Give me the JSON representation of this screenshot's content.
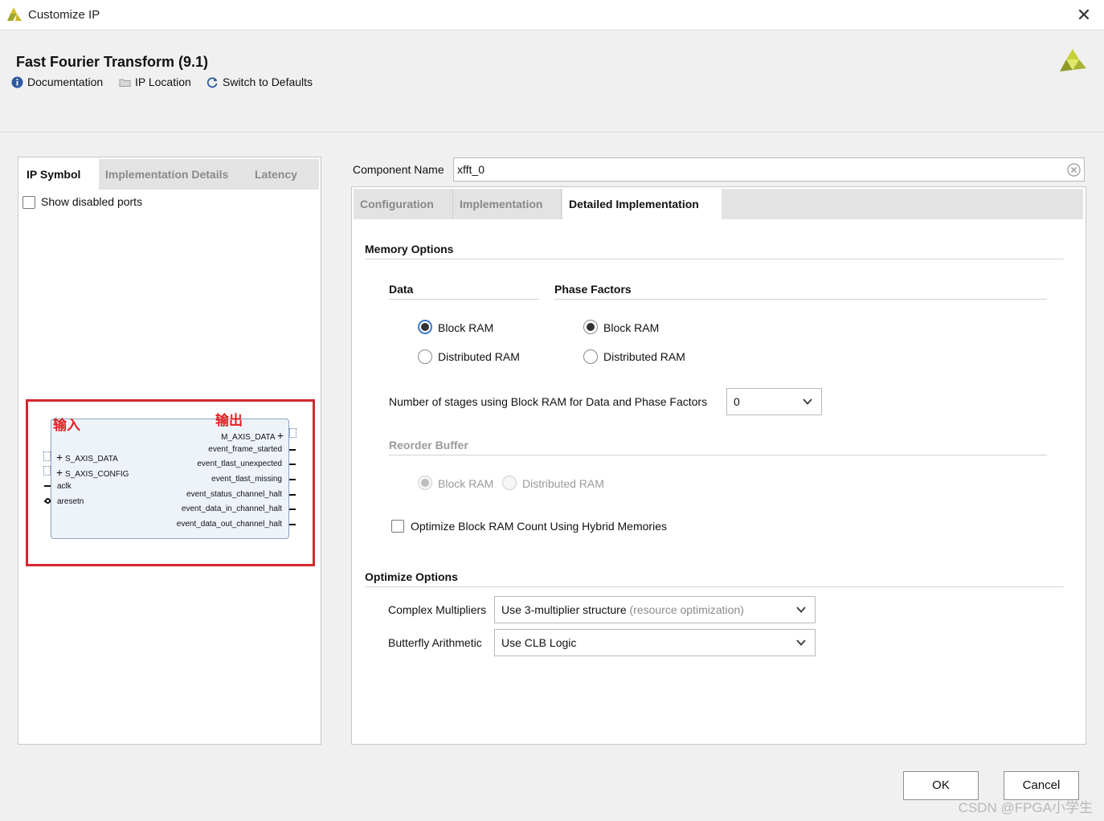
{
  "window": {
    "title": "Customize IP",
    "close_glyph": "✕"
  },
  "header": {
    "ip_title": "Fast Fourier Transform (9.1)",
    "links": [
      {
        "label": "Documentation",
        "icon": "info-icon"
      },
      {
        "label": "IP Location",
        "icon": "folder-icon"
      },
      {
        "label": "Switch to Defaults",
        "icon": "refresh-icon"
      }
    ]
  },
  "left_panel": {
    "tabs": [
      "IP Symbol",
      "Implementation Details",
      "Latency"
    ],
    "active_tab": "IP Symbol",
    "show_disabled_ports": {
      "label": "Show disabled ports",
      "checked": false
    },
    "symbol": {
      "inputs": [
        "S_AXIS_DATA",
        "S_AXIS_CONFIG",
        "aclk",
        "aresetn"
      ],
      "outputs": [
        "M_AXIS_DATA",
        "event_frame_started",
        "event_tlast_unexpected",
        "event_tlast_missing",
        "event_status_channel_halt",
        "event_data_in_channel_halt",
        "event_data_out_channel_halt"
      ],
      "annotation_input": "输入",
      "annotation_output": "输出"
    }
  },
  "right_panel": {
    "component_name_label": "Component Name",
    "component_name_value": "xfft_0",
    "tabs": [
      "Configuration",
      "Implementation",
      "Detailed Implementation"
    ],
    "active_tab": "Detailed Implementation",
    "memory_options": {
      "title": "Memory Options",
      "data": {
        "title": "Data",
        "options": [
          "Block RAM",
          "Distributed RAM"
        ],
        "selected": "Block RAM"
      },
      "phase_factors": {
        "title": "Phase Factors",
        "options": [
          "Block RAM",
          "Distributed RAM"
        ],
        "selected": "Block RAM"
      },
      "stages_label": "Number of stages using Block RAM for Data and Phase Factors",
      "stages_value": "0",
      "reorder_buffer": {
        "title": "Reorder Buffer",
        "options": [
          "Block RAM",
          "Distributed RAM"
        ],
        "selected": "Block RAM",
        "disabled": true
      },
      "hybrid": {
        "label": "Optimize Block RAM Count Using Hybrid Memories",
        "checked": false
      }
    },
    "optimize_options": {
      "title": "Optimize Options",
      "complex_multipliers_label": "Complex Multipliers",
      "complex_multipliers_value": "Use 3-multiplier structure",
      "complex_multipliers_hint": "(resource optimization)",
      "butterfly_label": "Butterfly Arithmetic",
      "butterfly_value": "Use CLB Logic"
    }
  },
  "buttons": {
    "ok": "OK",
    "cancel": "Cancel"
  },
  "watermark": "CSDN @FPGA小学生",
  "colors": {
    "annotation_red": "#d7262e",
    "focus_blue": "#3c78c8",
    "logo_yellow": "#b9c43a"
  }
}
